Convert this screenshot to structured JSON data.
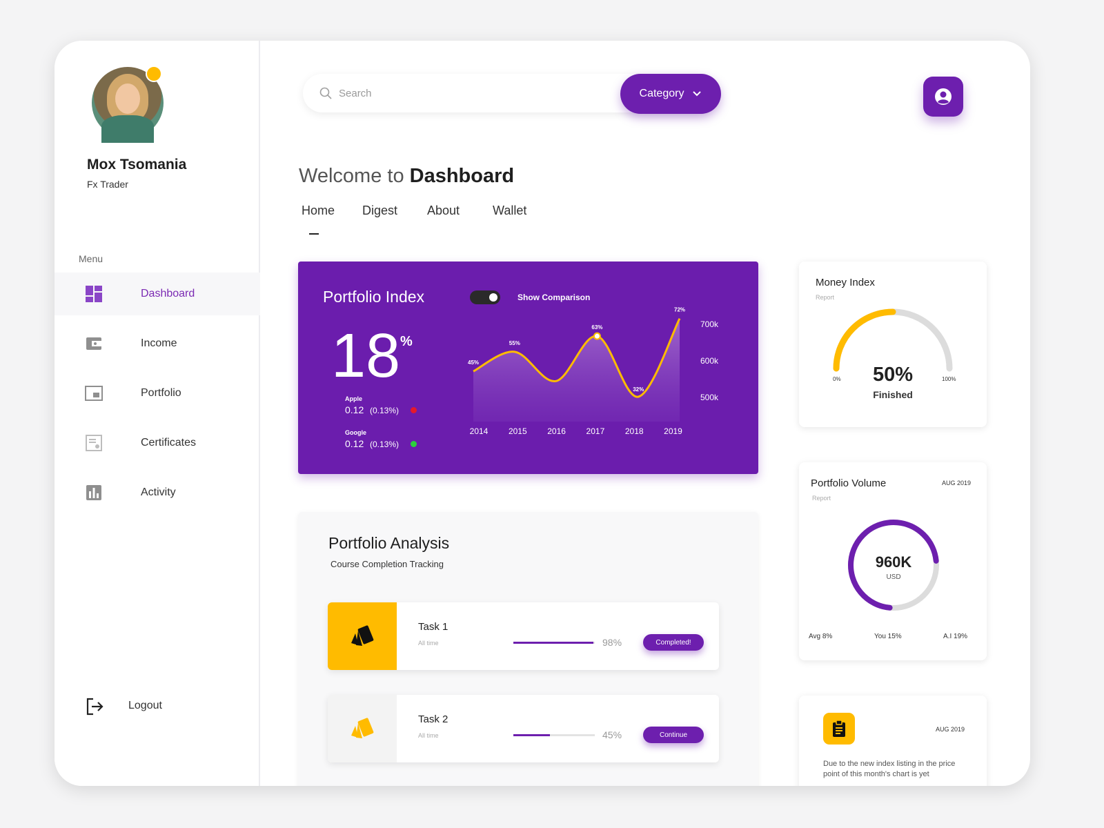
{
  "profile": {
    "name": "Mox Tsomania",
    "role": "Fx Trader"
  },
  "sidebar": {
    "menu_label": "Menu",
    "items": [
      {
        "label": "Dashboard",
        "icon": "dashboard-icon",
        "active": true
      },
      {
        "label": "Income",
        "icon": "wallet-icon"
      },
      {
        "label": "Portfolio",
        "icon": "portfolio-icon"
      },
      {
        "label": "Certificates",
        "icon": "certificate-icon"
      },
      {
        "label": "Activity",
        "icon": "bar-chart-icon"
      }
    ],
    "logout_label": "Logout"
  },
  "search": {
    "placeholder": "Search"
  },
  "category": {
    "label": "Category"
  },
  "welcome": {
    "prefix": "Welcome to",
    "title": "Dashboard"
  },
  "tabs": [
    "Home",
    "Digest",
    "About",
    "Wallet"
  ],
  "portfolio_index": {
    "title": "Portfolio Index",
    "toggle_label": "Show Comparison",
    "big_value": "18",
    "big_unit": "%",
    "stocks": [
      {
        "name": "Apple",
        "value": "0.12",
        "change": "(0.13%)",
        "color": "#e6192b"
      },
      {
        "name": "Google",
        "value": "0.12",
        "change": "(0.13%)",
        "color": "#2bd13c"
      }
    ]
  },
  "chart_data": {
    "type": "area",
    "x": [
      "2014",
      "2015",
      "2016",
      "2017",
      "2018",
      "2019"
    ],
    "point_labels": [
      "45%",
      "55%",
      "63%",
      "32%",
      "72%"
    ],
    "y_ticks": [
      "700k",
      "600k",
      "500k"
    ],
    "series": [
      {
        "values": [
          45,
          55,
          40,
          63,
          32,
          72
        ]
      }
    ],
    "line_color": "#ffbb00",
    "grid": false
  },
  "money_index": {
    "title": "Money Index",
    "sub": "Report",
    "value": "50%",
    "caption": "Finished",
    "min_label": "0%",
    "max_label": "100%",
    "progress": 0.5,
    "accent": "#ffbb00"
  },
  "portfolio_volume": {
    "title": "Portfolio Volume",
    "sub": "Report",
    "date": "AUG 2019",
    "value": "960K",
    "unit": "USD",
    "progress": 0.72,
    "stats": [
      "Avg 8%",
      "You 15%",
      "A.I 19%"
    ]
  },
  "note": {
    "date": "AUG 2019",
    "text": "Due to the new index listing in the price point of this month's chart is yet"
  },
  "analysis": {
    "title": "Portfolio Analysis",
    "sub": "Course Completion Tracking",
    "tasks": [
      {
        "name": "Task 1",
        "time": "All time",
        "pct_label": "98%",
        "progress": 0.98,
        "button": "Completed!"
      },
      {
        "name": "Task 2",
        "time": "All time",
        "pct_label": "45%",
        "progress": 0.45,
        "button": "Continue"
      }
    ]
  }
}
